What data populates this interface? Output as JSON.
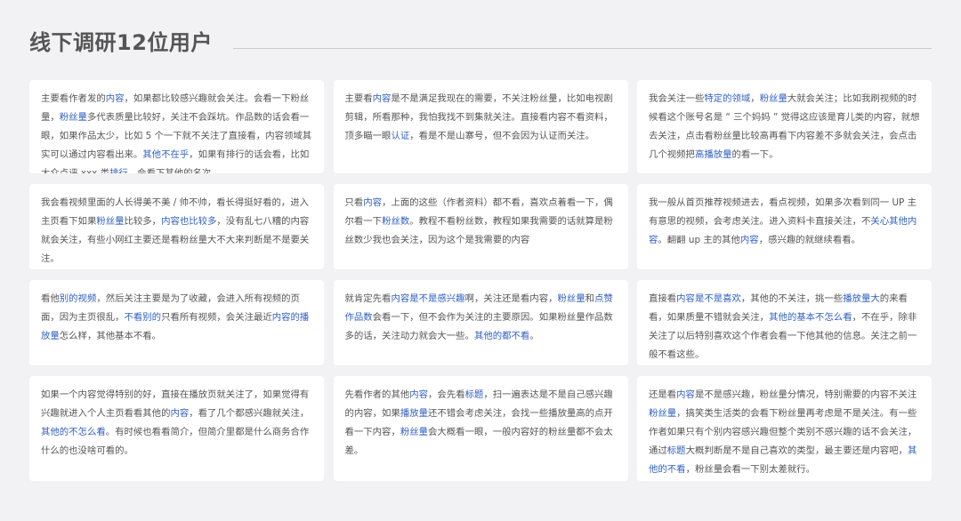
{
  "title": "线下调研12位用户",
  "colors": {
    "highlight": "#2f5fc4",
    "text": "#555555",
    "background": "#f2f2f4",
    "card": "#ffffff"
  },
  "cards": [
    [
      {
        "t": "主要看作者发的"
      },
      {
        "t": "内容",
        "h": 1
      },
      {
        "t": "，如果都比较感兴趣就会关注。会看一下粉丝量，"
      },
      {
        "t": "粉丝量",
        "h": 1
      },
      {
        "t": "多代表质量比较好，关注不会踩坑。作品数的话会看一眼，如果作品太少，比如 5 个一下就不关注了直接看，内容领域其实可以通过内容看出来。"
      },
      {
        "t": "其他不在乎",
        "h": 1
      },
      {
        "t": "，如果有排行的话会看，比如大众点评 xxx 类"
      },
      {
        "t": "排行",
        "h": 1
      },
      {
        "t": "，会看下其他的名次。"
      }
    ],
    [
      {
        "t": "主要看"
      },
      {
        "t": "内容",
        "h": 1
      },
      {
        "t": "是不是满足我现在的需要，不关注粉丝量，比如电视剧剪辑，所看那种，我怕我找不到集就关注。直接看内容不看资料，顶多瞄一眼"
      },
      {
        "t": "认证",
        "h": 1
      },
      {
        "t": "，看是不是山寨号，但不会因为认证而关注。"
      }
    ],
    [
      {
        "t": "我会关注一些"
      },
      {
        "t": "特定的领域",
        "h": 1
      },
      {
        "t": "，"
      },
      {
        "t": "粉丝量",
        "h": 1
      },
      {
        "t": "大就会关注；比如我刷视频的时候看这个账号名是 “ 三个妈妈 ” 觉得这应该是育儿类的内容，就想去关注，点击看粉丝量比较高再看下内容差不多就会关注，会点击几个视频把"
      },
      {
        "t": "高播放量",
        "h": 1
      },
      {
        "t": "的看一下。"
      }
    ],
    [
      {
        "t": "我会看视频里面的人长得美不美 / 帅不帅，看长得挺好看的，进入主页看下如果"
      },
      {
        "t": "粉丝量",
        "h": 1
      },
      {
        "t": "比较多，"
      },
      {
        "t": "内容也比较多",
        "h": 1
      },
      {
        "t": "，没有乱七八糟的内容就会关注，有些小网红主要还是看粉丝量大不大来判断是不是要关注。"
      }
    ],
    [
      {
        "t": "只看"
      },
      {
        "t": "内容",
        "h": 1
      },
      {
        "t": "，上面的这些（作者资料）都不看，喜欢点着看一下，偶尔看一下"
      },
      {
        "t": "粉丝数",
        "h": 1
      },
      {
        "t": "。教程不看粉丝数，教程如果我需要的话就算是粉丝数少我也会关注，因为这个是我需要的内容"
      }
    ],
    [
      {
        "t": "我一般从首页推荐视频进去，看点视频，如果多次看到同一 UP 主有意思的视频，会考虑关注。进入资料卡直接关注，不"
      },
      {
        "t": "关心其他内容",
        "h": 1
      },
      {
        "t": "。翻翻 up 主的其他"
      },
      {
        "t": "内容",
        "h": 1
      },
      {
        "t": "，感兴趣的就继续看看。"
      }
    ],
    [
      {
        "t": "看他"
      },
      {
        "t": "别的视频",
        "h": 1
      },
      {
        "t": "，然后关注主要是为了收藏，会进入所有视频的页面，因为主页很乱，"
      },
      {
        "t": "不看别的",
        "h": 1
      },
      {
        "t": "只看所有视频，会关注最近"
      },
      {
        "t": "内容的播放量",
        "h": 1
      },
      {
        "t": "怎么样，其他基本不看。"
      }
    ],
    [
      {
        "t": "就肯定先看"
      },
      {
        "t": "内容是不是感兴趣",
        "h": 1
      },
      {
        "t": "啊，关注还是看内容，"
      },
      {
        "t": "粉丝量",
        "h": 1
      },
      {
        "t": "和"
      },
      {
        "t": "点赞作品数",
        "h": 1
      },
      {
        "t": "会看一下，但不会作为关注的主要原因。如果粉丝量作品数多的话，关注动力就会大一些。"
      },
      {
        "t": "其他的都不看",
        "h": 1
      },
      {
        "t": "。"
      }
    ],
    [
      {
        "t": "直接看"
      },
      {
        "t": "内容是不是喜欢",
        "h": 1
      },
      {
        "t": "，其他的不关注，挑一些"
      },
      {
        "t": "播放量大",
        "h": 1
      },
      {
        "t": "的来看看，如果质量不错就会关注，"
      },
      {
        "t": "其他的基本不怎么看",
        "h": 1
      },
      {
        "t": "，不在乎，除非关注了以后特别喜欢这个作者会看一下他其他的信息。关注之前一般不看这些。"
      }
    ],
    [
      {
        "t": "如果一个内容觉得特别的好，直接在播放页就关注了，如果觉得有兴趣就进入个人主页看看其他的"
      },
      {
        "t": "内容",
        "h": 1
      },
      {
        "t": "，看了几个都感兴趣就关注，"
      },
      {
        "t": "其他的不怎么看",
        "h": 1
      },
      {
        "t": "。有时候也看看简介，但简介里都是什么商务合作什么的也没啥可看的。"
      }
    ],
    [
      {
        "t": "先看作者的其他"
      },
      {
        "t": "内容",
        "h": 1
      },
      {
        "t": "，会先看"
      },
      {
        "t": "标题",
        "h": 1
      },
      {
        "t": "，扫一遍表达是不是自己感兴趣的内容，如果"
      },
      {
        "t": "播放量",
        "h": 1
      },
      {
        "t": "还不错会考虑关注，会找一些播放量高的点开看一下内容，"
      },
      {
        "t": "粉丝量",
        "h": 1
      },
      {
        "t": "会大概看一眼，一般内容好的粉丝量都不会太差。"
      }
    ],
    [
      {
        "t": "还是看"
      },
      {
        "t": "内容",
        "h": 1
      },
      {
        "t": "是不是感兴趣，粉丝量分情况，特别需要的内容不关注"
      },
      {
        "t": "粉丝量",
        "h": 1
      },
      {
        "t": "，搞笑类生活类的会看下粉丝量再考虑是不是关注。有一些作者如果只有个别内容感兴趣但整个类别不感兴趣的话不会关注，通过"
      },
      {
        "t": "标题",
        "h": 1
      },
      {
        "t": "大概判断是不是自己喜欢的类型，最主要还是内容吧，"
      },
      {
        "t": "其他的不看",
        "h": 1
      },
      {
        "t": "，粉丝量会看一下别太差就行。"
      }
    ]
  ]
}
